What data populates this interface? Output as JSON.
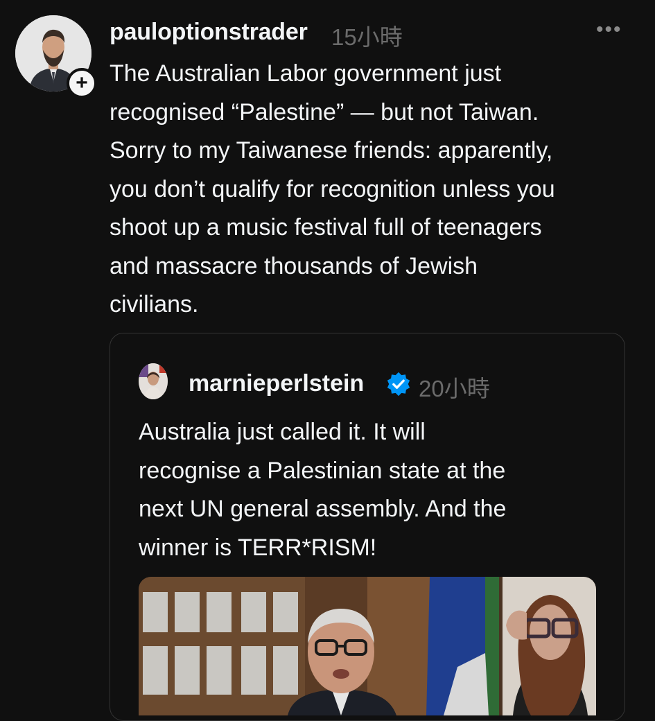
{
  "post": {
    "username": "pauloptionstrader",
    "timestamp": "15小時",
    "more_label": "•••",
    "follow_label": "+",
    "body": "The Australian Labor government just\nrecognised “Palestine” — but not Taiwan.\nSorry to my Taiwanese friends: apparently,\nyou don’t qualify for recognition unless you\nshoot up a music festival full of teenagers\nand massacre thousands of Jewish\ncivilians."
  },
  "quoted_post": {
    "username": "marnieperlstein",
    "verified": true,
    "timestamp": "20小時",
    "body": "Australia just called it. It will\nrecognise a Palestinian state at the\nnext UN general assembly. And the\nwinner is TERR*RISM!"
  },
  "colors": {
    "background": "#101010",
    "text": "#f3f5f7",
    "muted": "#6b6b6b",
    "verified_blue": "#0095f6",
    "card_border": "#343434"
  }
}
